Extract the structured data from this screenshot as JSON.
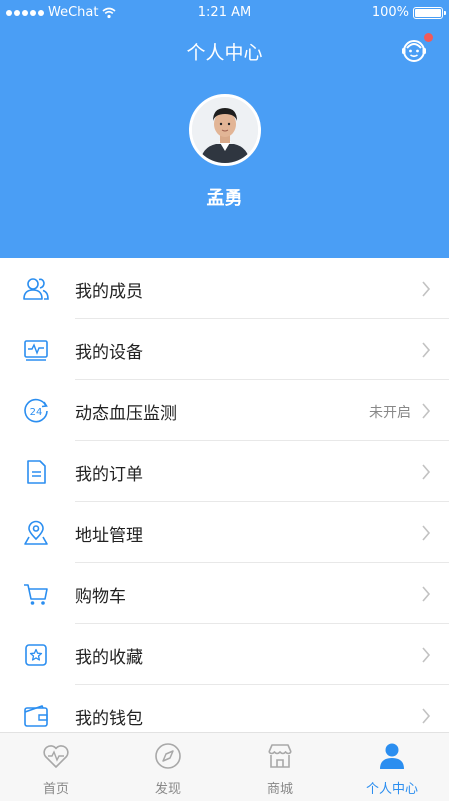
{
  "status_bar": {
    "carrier": "WeChat",
    "time": "1:21 AM",
    "battery": "100%"
  },
  "header": {
    "title": "个人中心",
    "username": "孟勇"
  },
  "menu": [
    {
      "label": "我的成员",
      "icon": "members-icon"
    },
    {
      "label": "我的设备",
      "icon": "device-icon"
    },
    {
      "label": "动态血压监测",
      "icon": "24h-monitor-icon",
      "status": "未开启"
    },
    {
      "label": "我的订单",
      "icon": "order-icon"
    },
    {
      "label": "地址管理",
      "icon": "location-icon"
    },
    {
      "label": "购物车",
      "icon": "cart-icon"
    },
    {
      "label": "我的收藏",
      "icon": "favorites-icon"
    },
    {
      "label": "我的钱包",
      "icon": "wallet-icon"
    }
  ],
  "tabbar": [
    {
      "label": "首页",
      "icon": "heart-pulse-icon"
    },
    {
      "label": "发现",
      "icon": "compass-icon"
    },
    {
      "label": "商城",
      "icon": "shop-icon"
    },
    {
      "label": "个人中心",
      "icon": "person-icon",
      "active": true
    }
  ],
  "colors": {
    "primary": "#4a9ef5",
    "active_tab": "#2b8ef0",
    "badge": "#f05a5a"
  }
}
